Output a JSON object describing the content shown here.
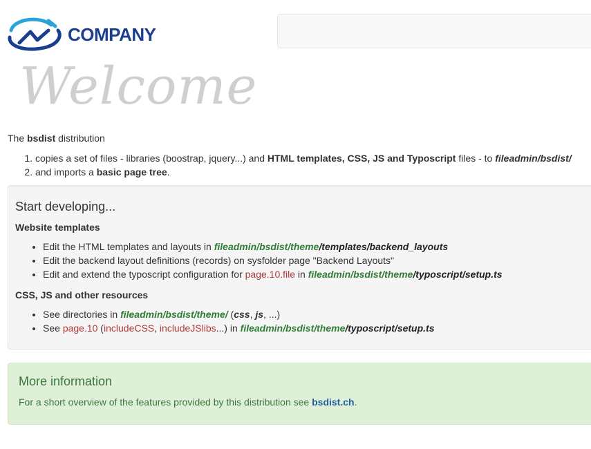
{
  "header": {
    "logo_text": "COMPANY",
    "brand_color": "#1b3f8f",
    "accent_color": "#2aa3d8"
  },
  "welcome_heading": "Welcome",
  "intro": {
    "p_prefix": "The ",
    "p_bold": "bsdist",
    "p_suffix": " distribution",
    "items": [
      {
        "t1": "copies a set of files - libraries (boostrap, jquery...) and ",
        "b1": "HTML templates, CSS, JS and Typoscript",
        "t2": " files - to ",
        "bi": "fileadmin/bsdist/"
      },
      {
        "t1": "and imports a ",
        "b1": "basic page tree",
        "t2": "."
      }
    ]
  },
  "develop": {
    "title": "Start developing...",
    "website_templates": {
      "heading": "Website templates",
      "items": [
        {
          "t1": "Edit the HTML templates and layouts in ",
          "path": "fileadmin/bsdist/theme",
          "tail": "/templates/backend_layouts"
        },
        {
          "t1": "Edit the backend layout definitions (records) on sysfolder page \"Backend Layouts\""
        },
        {
          "t1": "Edit and extend the typoscript configuration for ",
          "code": "page.10.file",
          "t2": " in ",
          "path": "fileadmin/bsdist/theme",
          "tail": "/typoscript/setup.ts"
        }
      ]
    },
    "resources": {
      "heading": "CSS, JS and other resources",
      "items": [
        {
          "t1": "See directories in ",
          "path": "fileadmin/bsdist/theme/",
          "t2": " (",
          "b1": "css",
          "t3": ", ",
          "b2": "js",
          "t4": ", ...)"
        },
        {
          "t1": "See ",
          "code1": "page.10",
          "t2": " (",
          "code2": "includeCSS",
          "t3": ", ",
          "code3": "includeJSlibs",
          "t4": "...) in ",
          "path": "fileadmin/bsdist/theme",
          "tail": "/typoscript/setup.ts"
        }
      ]
    }
  },
  "more_info": {
    "title": "More information",
    "text": "For a short overview of the features provided by this distribution see ",
    "link": "bsdist.ch",
    "after": "."
  }
}
